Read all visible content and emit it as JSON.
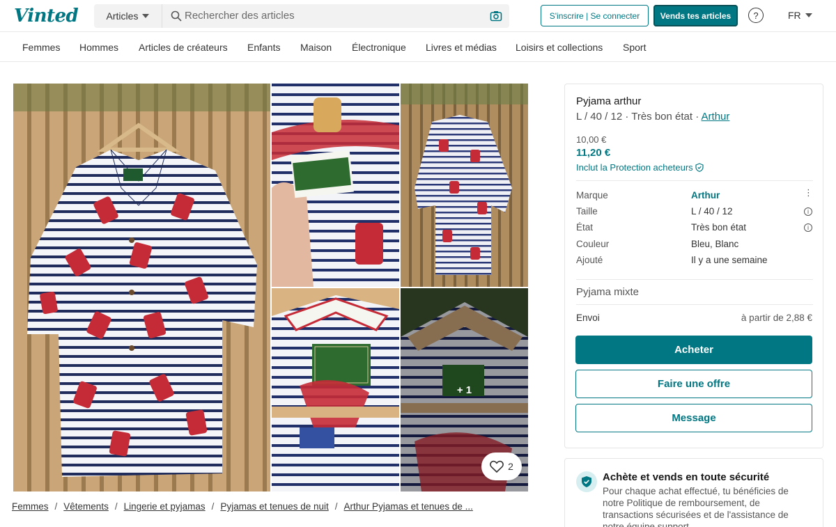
{
  "header": {
    "logo": "Vinted",
    "search_category": "Articles",
    "search_placeholder": "Rechercher des articles",
    "signup_label": "S'inscrire | Se connecter",
    "sell_label": "Vends tes articles",
    "help_label": "?",
    "language": "FR"
  },
  "nav": {
    "items": [
      "Femmes",
      "Hommes",
      "Articles de créateurs",
      "Enfants",
      "Maison",
      "Électronique",
      "Livres et médias",
      "Loisirs et collections",
      "Sport"
    ]
  },
  "gallery": {
    "more_label": "+ 1",
    "favourites_count": "2"
  },
  "breadcrumb": {
    "items": [
      "Femmes",
      "Vêtements",
      "Lingerie et pyjamas",
      "Pyjamas et tenues de nuit",
      "Arthur Pyjamas et tenues de ..."
    ],
    "separator": "/"
  },
  "item": {
    "title": "Pyjama arthur",
    "subtitle": "L / 40 / 12 · Très bon état · ",
    "brand_link": "Arthur",
    "original_price": "10,00 €",
    "price": "11,20 €",
    "protection": "Inclut la Protection acheteurs",
    "details": [
      {
        "label": "Marque",
        "value": "Arthur"
      },
      {
        "label": "Taille",
        "value": "L / 40 / 12"
      },
      {
        "label": "État",
        "value": "Très bon état"
      },
      {
        "label": "Couleur",
        "value": "Bleu, Blanc"
      },
      {
        "label": "Ajouté",
        "value": "Il y a une semaine"
      }
    ],
    "description": "Pyjama mixte",
    "shipping_label": "Envoi",
    "shipping_value": "à partir de 2,88 €",
    "buy_label": "Acheter",
    "offer_label": "Faire une offre",
    "message_label": "Message"
  },
  "safety": {
    "title": "Achète et vends en toute sécurité",
    "text": "Pour chaque achat effectué, tu bénéficies de notre Politique de remboursement, de transactions sécurisées et de l'assistance de notre équipe support."
  },
  "colors": {
    "brand": "#007782",
    "stripe_navy": "#1f2c5c",
    "stripe_red": "#c52b36",
    "wood": "#c7a276"
  }
}
